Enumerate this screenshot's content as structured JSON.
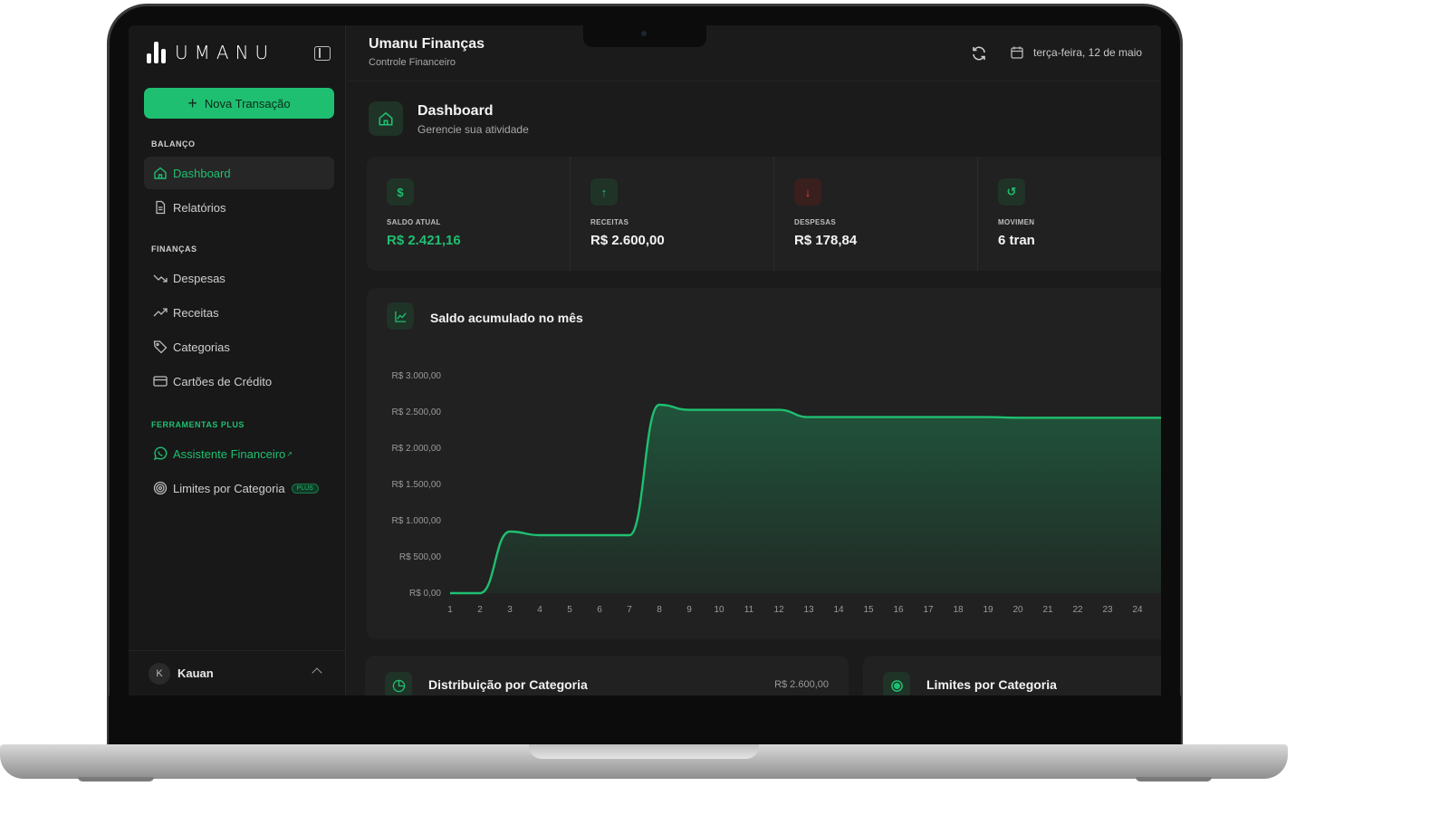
{
  "brand": {
    "name": "UMANU"
  },
  "sidebar": {
    "new_transaction": "Nova Transação",
    "sections": [
      {
        "title": "BALANÇO",
        "items": [
          {
            "label": "Dashboard",
            "icon": "home-icon",
            "active": true
          },
          {
            "label": "Relatórios",
            "icon": "document-icon"
          }
        ]
      },
      {
        "title": "FINANÇAS",
        "items": [
          {
            "label": "Despesas",
            "icon": "trending-down-icon"
          },
          {
            "label": "Receitas",
            "icon": "trending-up-icon"
          },
          {
            "label": "Categorias",
            "icon": "tag-icon"
          },
          {
            "label": "Cartões de Crédito",
            "icon": "credit-card-icon"
          }
        ]
      },
      {
        "title": "FERRAMENTAS PLUS",
        "items": [
          {
            "label": "Assistente Financeiro",
            "icon": "whatsapp-icon"
          },
          {
            "label": "Limites por Categoria",
            "icon": "target-icon",
            "badge": "PLUS"
          }
        ]
      }
    ],
    "user": {
      "initial": "K",
      "name": "Kauan"
    }
  },
  "topbar": {
    "title": "Umanu Finanças",
    "subtitle": "Controle Financeiro",
    "date": "terça-feira, 12 de maio"
  },
  "page": {
    "title": "Dashboard",
    "subtitle": "Gerencie sua atividade"
  },
  "stats": [
    {
      "label": "SALDO ATUAL",
      "value": "R$ 2.421,16",
      "icon": "$",
      "icon_name": "dollar-icon",
      "color": "#1fbf71"
    },
    {
      "label": "RECEITAS",
      "value": "R$ 2.600,00",
      "icon": "↑",
      "icon_name": "arrow-up-icon",
      "color": "#1fbf71"
    },
    {
      "label": "DESPESAS",
      "value": "R$ 178,84",
      "icon": "↓",
      "icon_name": "arrow-down-icon",
      "color": "#e0453a"
    },
    {
      "label": "MOVIMEN",
      "value": "6 tran",
      "icon": "↺",
      "icon_name": "history-icon",
      "color": "#1fbf71"
    }
  ],
  "chart": {
    "title": "Saldo acumulado no mês"
  },
  "chart_data": {
    "type": "area",
    "title": "Saldo acumulado no mês",
    "x": [
      1,
      2,
      3,
      4,
      5,
      6,
      7,
      8,
      9,
      10,
      11,
      12,
      13,
      14,
      15,
      16,
      17,
      18,
      19,
      20,
      21,
      22,
      23,
      24
    ],
    "y": [
      0,
      0,
      850,
      800,
      800,
      800,
      800,
      2600,
      2530,
      2530,
      2530,
      2530,
      2430,
      2430,
      2430,
      2430,
      2430,
      2430,
      2430,
      2421.16,
      2421.16,
      2421.16,
      2421.16,
      2421.16
    ],
    "ylim": [
      0,
      3000
    ],
    "y_ticks": [
      "R$ 0,00",
      "R$ 500,00",
      "R$ 1.000,00",
      "R$ 1.500,00",
      "R$ 2.000,00",
      "R$ 2.500,00",
      "R$ 3.000,00"
    ],
    "y_tick_values": [
      0,
      500,
      1000,
      1500,
      2000,
      2500,
      3000
    ],
    "grid": false,
    "color": "#1fbf71"
  },
  "bottom_cards": [
    {
      "title": "Distribuição por Categoria",
      "amount": "R$ 2.600,00"
    },
    {
      "title": "Limites por Categoria",
      "amount": ""
    }
  ]
}
